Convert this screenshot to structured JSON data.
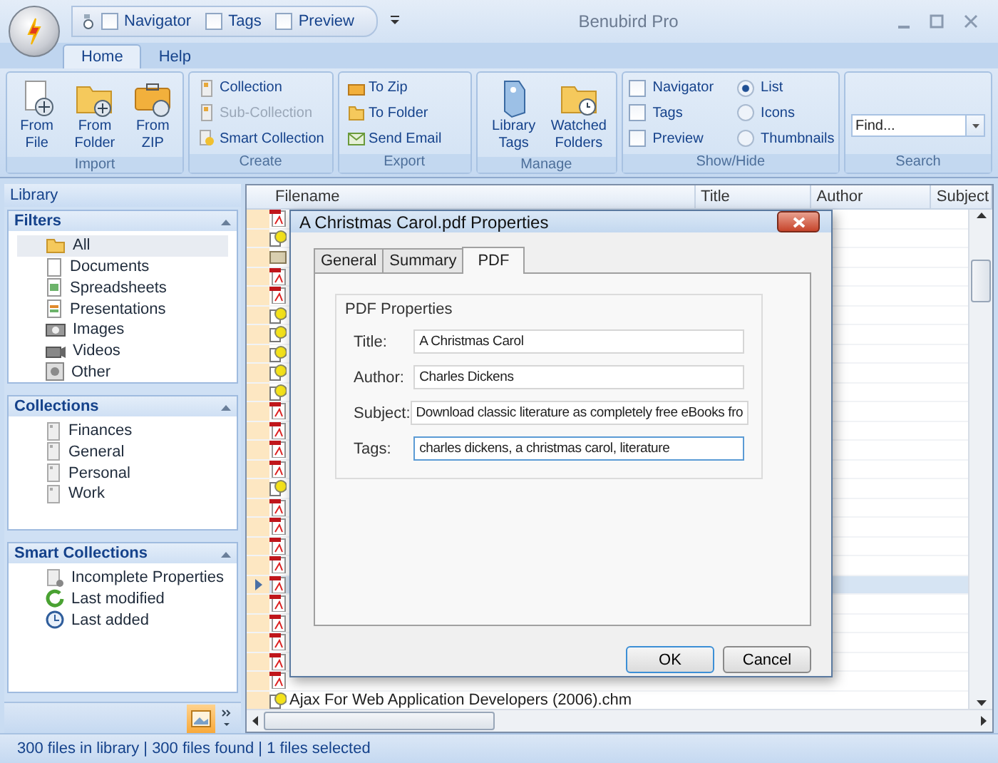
{
  "window": {
    "title": "Benubird Pro"
  },
  "quick_access": [
    {
      "label": "Navigator",
      "checked": false
    },
    {
      "label": "Tags",
      "checked": false
    },
    {
      "label": "Preview",
      "checked": false
    }
  ],
  "ribbon_tabs": [
    {
      "label": "Home",
      "selected": true
    },
    {
      "label": "Help",
      "selected": false
    }
  ],
  "ribbon_groups": [
    {
      "kind": "large",
      "title": "Import",
      "buttons": [
        {
          "label": "From File",
          "kind": "file"
        },
        {
          "label": "From Folder",
          "kind": "folder"
        },
        {
          "label": "From ZIP",
          "kind": "zip"
        }
      ]
    },
    {
      "kind": "small",
      "title": "Create",
      "buttons": [
        {
          "label": "Collection",
          "kind": "collection",
          "disabled": false
        },
        {
          "label": "Sub-Collection",
          "kind": "collection",
          "disabled": true
        },
        {
          "label": "Smart Collection",
          "kind": "smart",
          "disabled": false
        }
      ]
    },
    {
      "kind": "small",
      "title": "Export",
      "buttons": [
        {
          "label": "To Zip",
          "kind": "zip",
          "disabled": false
        },
        {
          "label": "To Folder",
          "kind": "folder",
          "disabled": false
        },
        {
          "label": "Send Email",
          "kind": "email",
          "disabled": false
        }
      ]
    },
    {
      "kind": "large",
      "title": "Manage",
      "buttons": [
        {
          "label": "Library Tags",
          "kind": "tag"
        },
        {
          "label": "Watched Folders",
          "kind": "watch"
        }
      ]
    },
    {
      "kind": "showhide",
      "title": "Show/Hide",
      "checks": [
        {
          "label": "Navigator",
          "checked": false
        },
        {
          "label": "Tags",
          "checked": false
        },
        {
          "label": "Preview",
          "checked": false
        }
      ],
      "views": [
        {
          "label": "List",
          "selected": true
        },
        {
          "label": "Icons",
          "selected": false
        },
        {
          "label": "Thumbnails",
          "selected": false
        }
      ]
    },
    {
      "kind": "search",
      "title": "Search",
      "placeholder": "Find..."
    }
  ],
  "library": {
    "title": "Library",
    "sections": [
      {
        "title": "Filters",
        "expanded": true,
        "items": [
          {
            "label": "All",
            "kind": "folder",
            "selected": true
          },
          {
            "label": "Documents",
            "kind": "document",
            "selected": false
          },
          {
            "label": "Spreadsheets",
            "kind": "spreadsheet",
            "selected": false
          },
          {
            "label": "Presentations",
            "kind": "presentation",
            "selected": false
          },
          {
            "label": "Images",
            "kind": "image",
            "selected": false
          },
          {
            "label": "Videos",
            "kind": "video",
            "selected": false
          },
          {
            "label": "Other",
            "kind": "other",
            "selected": false
          }
        ]
      },
      {
        "title": "Collections",
        "expanded": true,
        "items": [
          {
            "label": "Finances",
            "kind": "collection",
            "selected": false
          },
          {
            "label": "General",
            "kind": "collection",
            "selected": false
          },
          {
            "label": "Personal",
            "kind": "collection",
            "selected": false
          },
          {
            "label": "Work",
            "kind": "collection",
            "selected": false
          }
        ]
      },
      {
        "title": "Smart Collections",
        "expanded": true,
        "items": [
          {
            "label": "Incomplete Properties",
            "kind": "incomplete",
            "selected": false
          },
          {
            "label": "Last modified",
            "kind": "modified",
            "selected": false
          },
          {
            "label": "Last added",
            "kind": "added",
            "selected": false
          }
        ]
      }
    ]
  },
  "grid": {
    "columns": [
      "Filename",
      "Title",
      "Author",
      "Subject"
    ],
    "rows": [
      {
        "kind": "pdf",
        "selected": false
      },
      {
        "kind": "unknown",
        "selected": false
      },
      {
        "kind": "fb2",
        "selected": false
      },
      {
        "kind": "pdf",
        "selected": false
      },
      {
        "kind": "pdf",
        "selected": false
      },
      {
        "kind": "unknown",
        "selected": false
      },
      {
        "kind": "unknown",
        "selected": false
      },
      {
        "kind": "unknown",
        "selected": false
      },
      {
        "kind": "unknown",
        "selected": false
      },
      {
        "kind": "unknown",
        "selected": false
      },
      {
        "kind": "pdf",
        "selected": false
      },
      {
        "kind": "pdf",
        "selected": false
      },
      {
        "kind": "pdf",
        "selected": false
      },
      {
        "kind": "pdf",
        "selected": false
      },
      {
        "kind": "unknown",
        "selected": false
      },
      {
        "kind": "pdf",
        "selected": false
      },
      {
        "kind": "pdf",
        "selected": false
      },
      {
        "kind": "pdf",
        "selected": false
      },
      {
        "kind": "pdf",
        "selected": false
      },
      {
        "kind": "pdf",
        "selected": true
      },
      {
        "kind": "pdf",
        "selected": false
      },
      {
        "kind": "pdf",
        "selected": false
      },
      {
        "kind": "pdf",
        "selected": false
      },
      {
        "kind": "pdf",
        "selected": false
      },
      {
        "kind": "pdf",
        "selected": false
      },
      {
        "kind": "unknown",
        "selected": false,
        "filename": "Ajax For Web Application Developers (2006).chm"
      }
    ]
  },
  "dialog": {
    "title": "A Christmas Carol.pdf Properties",
    "tabs": [
      {
        "label": "General",
        "selected": false
      },
      {
        "label": "Summary",
        "selected": false
      },
      {
        "label": "PDF",
        "selected": true
      }
    ],
    "group_title": "PDF Properties",
    "fields": [
      {
        "label": "Title:",
        "value": "A Christmas Carol",
        "focused": false
      },
      {
        "label": "Author:",
        "value": "Charles Dickens",
        "focused": false
      },
      {
        "label": "Subject:",
        "value": "Download classic literature as completely free eBooks fro",
        "focused": false
      },
      {
        "label": "Tags:",
        "value": "charles dickens, a christmas carol, literature",
        "focused": true
      }
    ],
    "buttons": [
      {
        "label": "OK",
        "default": true
      },
      {
        "label": "Cancel",
        "default": false
      }
    ]
  },
  "status_bar": "300 files in library | 300 files found | 1 files selected"
}
